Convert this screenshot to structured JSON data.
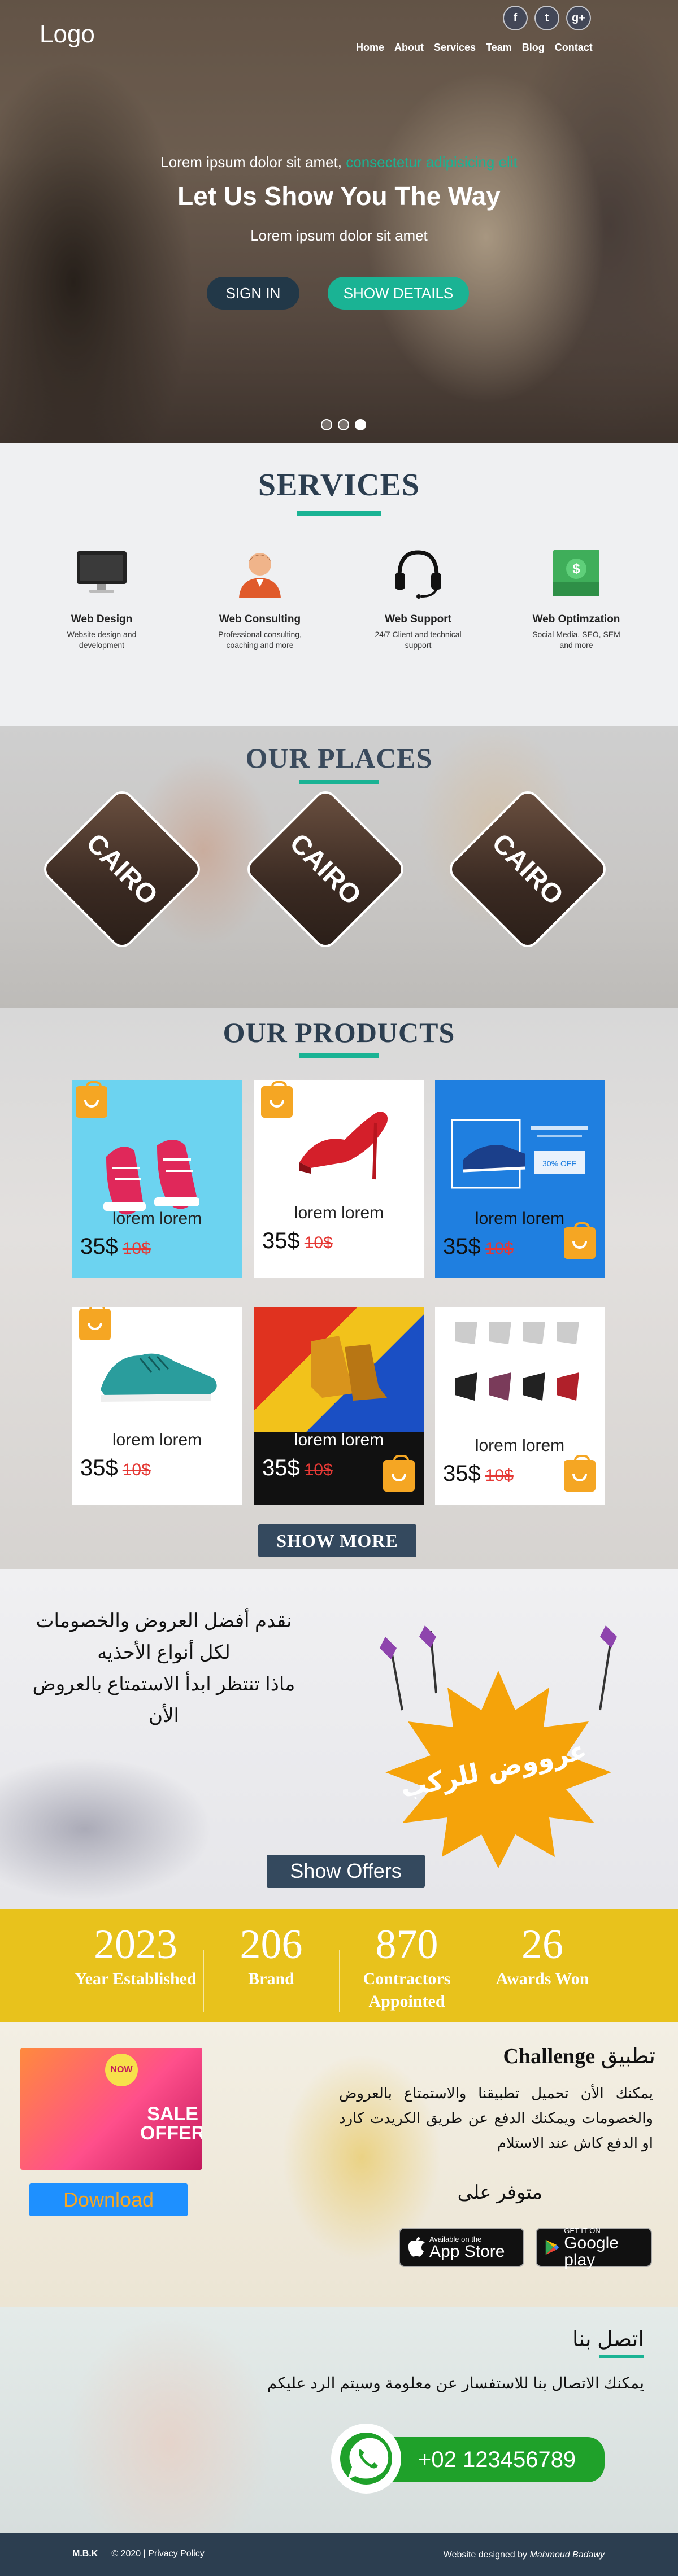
{
  "header": {
    "logo": "Logo",
    "social": [
      "f",
      "t",
      "g+"
    ],
    "nav": [
      "Home",
      "About",
      "Services",
      "Team",
      "Blog",
      "Contact"
    ]
  },
  "hero": {
    "kicker_prefix": "Lorem ipsum dolor sit amet,",
    "kicker_accent": " consectetur adipisicing elit",
    "title": "Let Us Show You The Way",
    "subtitle": "Lorem ipsum dolor sit amet",
    "signin_label": "SIGN IN",
    "details_label": "SHOW DETAILS",
    "slides": 3,
    "active_slide": 3
  },
  "services": {
    "title": "SERVICES",
    "items": [
      {
        "icon": "monitor-icon",
        "title": "Web Design",
        "desc": "Website design and development"
      },
      {
        "icon": "consultant-icon",
        "title": "Web Consulting",
        "desc": "Professional consulting, coaching and more"
      },
      {
        "icon": "headset-icon",
        "title": "Web Support",
        "desc": "24/7 Client and technical support"
      },
      {
        "icon": "money-icon",
        "title": "Web Optimzation",
        "desc": "Social Media, SEO, SEM and more"
      }
    ]
  },
  "places": {
    "title": "OUR PLACES",
    "items": [
      "CAIRO",
      "CAIRO",
      "CAIRO"
    ]
  },
  "products": {
    "title": "OUR PRODUCTS",
    "items": [
      {
        "name": "lorem lorem",
        "price": "35$",
        "old_price": "10$",
        "bg": "#6cd3f0"
      },
      {
        "name": "lorem lorem",
        "price": "35$",
        "old_price": "10$",
        "bg": "#ffffff"
      },
      {
        "name": "lorem lorem",
        "price": "35$",
        "old_price": "10$",
        "bg": "#1f7fe0"
      },
      {
        "name": "lorem lorem",
        "price": "35$",
        "old_price": "10$",
        "bg": "#ffffff"
      },
      {
        "name": "lorem lorem",
        "price": "35$",
        "old_price": "10$",
        "bg": "#e0321f"
      },
      {
        "name": "lorem lorem",
        "price": "35$",
        "old_price": "10$",
        "bg": "#ffffff"
      }
    ],
    "show_more_label": "SHOW MORE"
  },
  "offers": {
    "lines": [
      "نقدم أفضل العروض والخصومات",
      "لكل أنواع الأحذيه",
      "ماذا تنتظر ابدأ الاستمتاع بالعروض الأن"
    ],
    "burst_text": "عرووض للركب",
    "show_offers_label": "Show Offers"
  },
  "stats": [
    {
      "num": "2023",
      "label": "Year Established"
    },
    {
      "num": "206",
      "label": "Brand"
    },
    {
      "num": "870",
      "label": "Contractors Appointed"
    },
    {
      "num": "26",
      "label": "Awards Won"
    }
  ],
  "app": {
    "promo_badge": "NOW",
    "promo_text": "SALE OFFER",
    "download_label": "Download",
    "title_ar": "تطبيق",
    "title_en": "Challenge",
    "desc": "يمكنك الأن تحميل تطبيقنا والاستمتاع بالعروض والخصومات ويمكنك الدفع عن طريق الكريدت كارد او الدفع كاش عند الاستلام",
    "available": "متوفر على",
    "appstore_small": "Available on the",
    "appstore_big": "App Store",
    "gplay_small": "GET IT ON",
    "gplay_big": "Google play"
  },
  "contact": {
    "title": "اتصل بنا",
    "desc": "يمكنك الاتصال بنا للاستفسار عن معلومة وسيتم الرد عليكم",
    "phone": "+02 123456789"
  },
  "footer": {
    "brand": "M.B.K",
    "copyright": "© 2020 | Privacy Policy",
    "credit_prefix": "Website designed by ",
    "credit_name": "Mahmoud Badawy"
  }
}
